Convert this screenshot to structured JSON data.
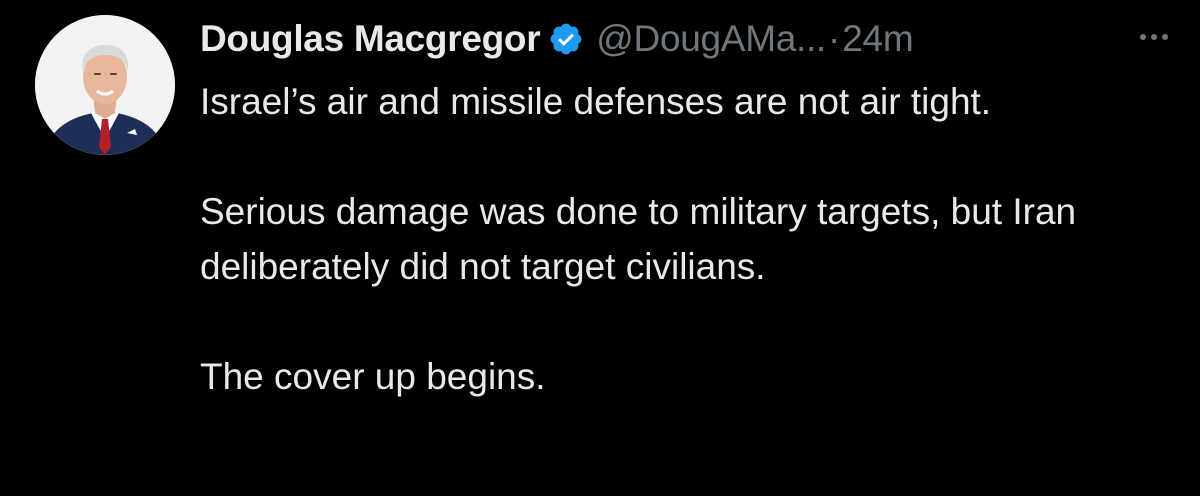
{
  "tweet": {
    "author": {
      "display_name": "Douglas Macgregor",
      "handle": "@DougAMa...",
      "verified": true,
      "verified_icon": "verified-badge-icon",
      "avatar_icon": "profile-photo"
    },
    "separator": "·",
    "time": "24m",
    "more_icon": "more-options-icon",
    "paragraphs": [
      "Israel’s air and missile defenses are not air tight.",
      "Serious damage was done to military targets, but Iran deliberately did not target civilians.",
      "The cover up begins."
    ]
  },
  "colors": {
    "background": "#000000",
    "primary_text": "#e7e9ea",
    "secondary_text": "#71767b",
    "verified_blue": "#1d9bf0"
  }
}
